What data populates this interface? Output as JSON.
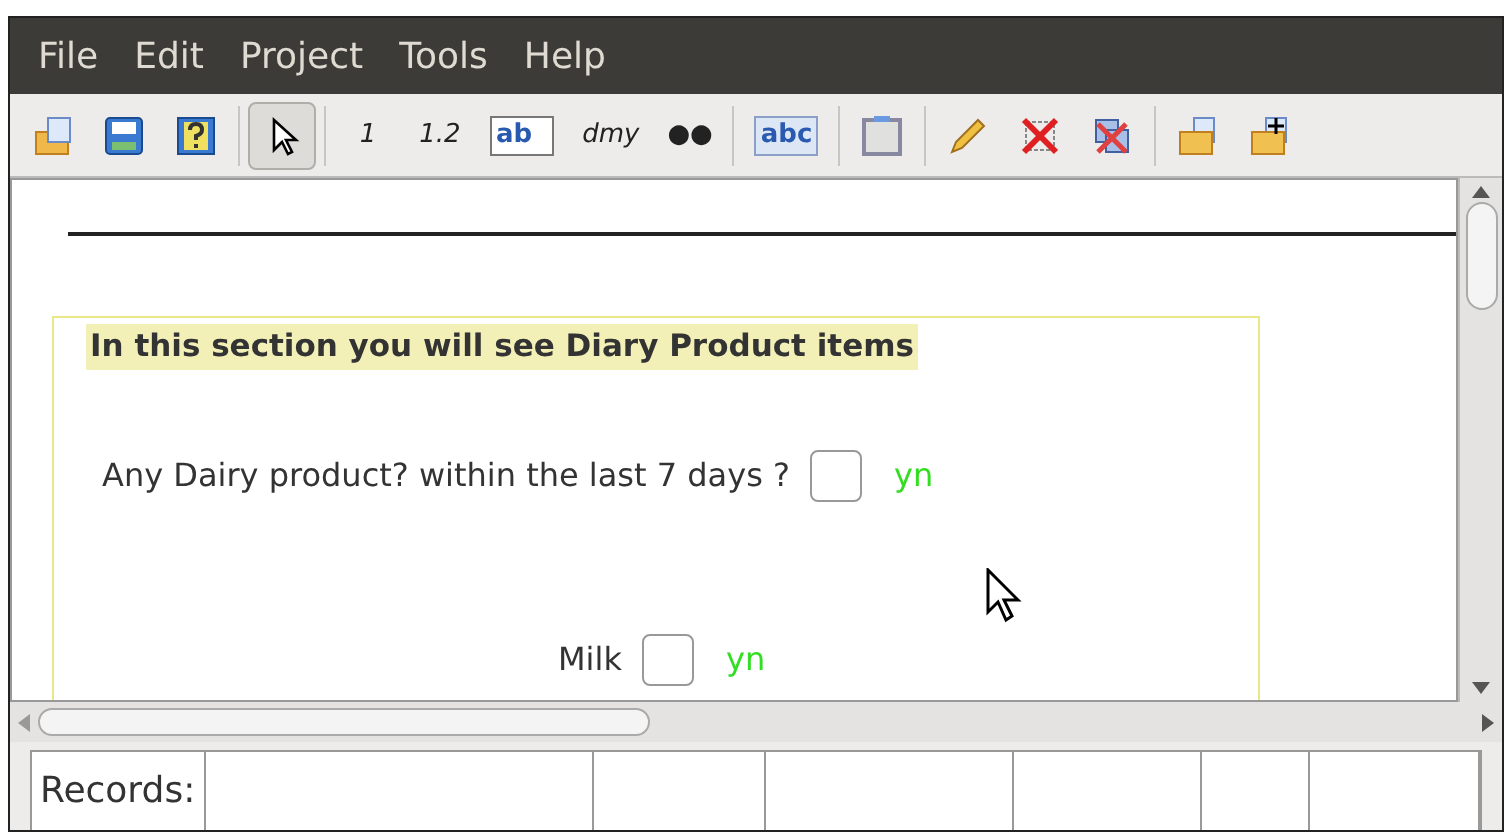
{
  "menu": [
    "File",
    "Edit",
    "Project",
    "Tools",
    "Help"
  ],
  "toolbar": [
    {
      "kind": "open",
      "selected": false
    },
    {
      "kind": "save",
      "selected": false
    },
    {
      "kind": "help",
      "selected": false
    },
    {
      "kind": "pointer",
      "selected": true
    },
    {
      "kind": "text",
      "label": "1",
      "selected": false
    },
    {
      "kind": "text",
      "label": "1.2",
      "selected": false
    },
    {
      "kind": "field",
      "label": "ab",
      "selected": false
    },
    {
      "kind": "text",
      "label": "dmy",
      "selected": false
    },
    {
      "kind": "text",
      "label": "●●",
      "selected": false
    },
    {
      "kind": "label",
      "label": "abc",
      "selected": false
    },
    {
      "kind": "box",
      "selected": false
    },
    {
      "kind": "pencil",
      "selected": false
    },
    {
      "kind": "delete",
      "selected": false
    },
    {
      "kind": "delete-copy",
      "selected": false
    },
    {
      "kind": "folder",
      "selected": false
    },
    {
      "kind": "folder-add",
      "selected": false
    }
  ],
  "form": {
    "section_title": "In this section you will see Diary Product items",
    "questions": [
      {
        "label": "Any Dairy product? within the last 7 days ?",
        "checked": false,
        "type": "yn"
      },
      {
        "label": "Milk",
        "checked": false,
        "type": "yn"
      }
    ]
  },
  "status_bar": {
    "label": "Records:"
  }
}
